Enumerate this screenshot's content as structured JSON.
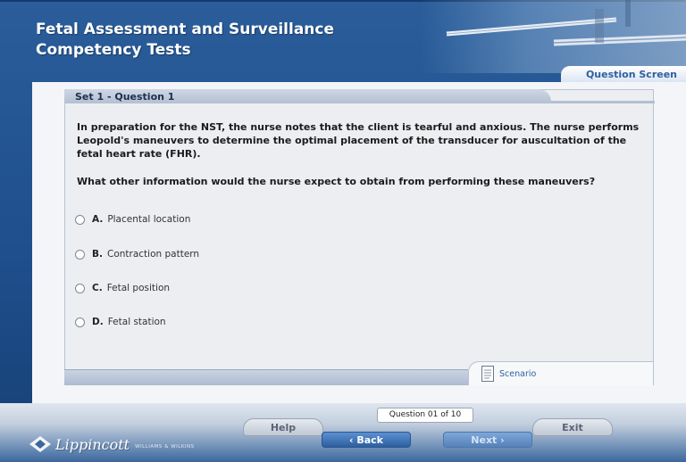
{
  "header": {
    "title_line1": "Fetal Assessment and Surveillance",
    "title_line2": "Competency Tests",
    "screen_label": "Question Screen"
  },
  "question": {
    "set_label": "Set 1 - Question 1",
    "text": "In preparation for the NST, the nurse notes that the client is tearful and anxious. The nurse performs Leopold's maneuvers to determine the optimal placement of the transducer for auscultation of the fetal heart rate (FHR).",
    "prompt": "What other information would the nurse expect to obtain from performing these maneuvers?",
    "options": [
      {
        "letter": "A.",
        "text": "Placental location"
      },
      {
        "letter": "B.",
        "text": "Contraction pattern"
      },
      {
        "letter": "C.",
        "text": "Fetal position"
      },
      {
        "letter": "D.",
        "text": "Fetal station"
      }
    ],
    "scenario_label": "Scenario",
    "scenario_icon": "document-icon"
  },
  "footer": {
    "counter": "Question 01 of 10",
    "help_label": "Help",
    "back_label": "Back",
    "next_label": "Next",
    "exit_label": "Exit",
    "back_chevron": "‹",
    "next_chevron": "›",
    "logo_text": "Lippincott",
    "logo_sub": "WILLIAMS & WILKINS"
  },
  "colors": {
    "accent_blue": "#2f5f9e",
    "header_bg": "#1f4f8c",
    "panel_bg": "#eceef1",
    "tab_bg": "#b3bfd3"
  }
}
